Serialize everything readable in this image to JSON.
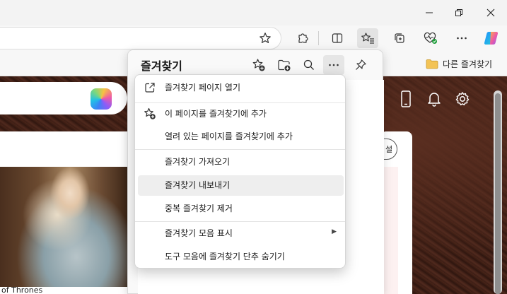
{
  "favorites_bar": {
    "folder_label": "다른 즐겨찾기"
  },
  "favorites_panel": {
    "title": "즐겨찾기"
  },
  "menu": {
    "items": [
      {
        "label": "즐겨찾기 페이지 열기",
        "icon": "open-external-icon"
      },
      {
        "label": "이 페이지를 즐겨찾기에 추가",
        "icon": "star-add-icon"
      },
      {
        "label": "열려 있는 페이지를 즐겨찾기에 추가",
        "icon": ""
      },
      {
        "label": "즐겨찾기 가져오기",
        "icon": ""
      },
      {
        "label": "즐겨찾기 내보내기",
        "icon": ""
      },
      {
        "label": "중복 즐겨찾기 제거",
        "icon": ""
      },
      {
        "label": "즐겨찾기 모음 표시",
        "icon": "",
        "submenu": true
      },
      {
        "label": "도구 모음에 즐겨찾기 단추 숨기기",
        "icon": ""
      }
    ]
  },
  "page": {
    "photo_caption": "of Thrones",
    "pill_text": "설"
  },
  "colors": {
    "accent_green": "#1f9d3a",
    "page_brown": "#3c1e15",
    "hover_gray": "#eeeeee"
  }
}
